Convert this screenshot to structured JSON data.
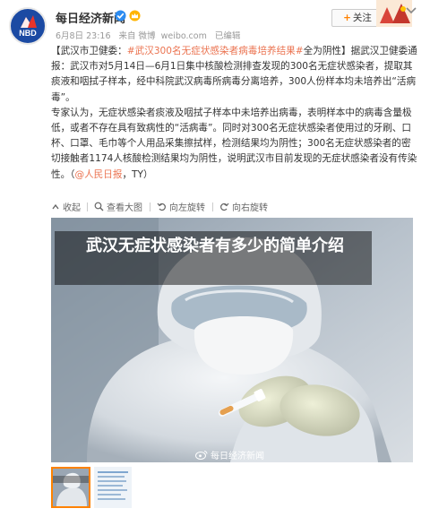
{
  "header": {
    "account_name": "每日经济新闻",
    "logo_text": "NBD",
    "meta": {
      "date": "6月8日 23:16",
      "source_prefix": "来自",
      "source": "微博",
      "domain": "weibo.com",
      "status": "已编辑"
    },
    "follow_label": "+关注",
    "follow_plus": "+",
    "follow_text": "关注"
  },
  "post": {
    "p1_open": "【",
    "p1_place": "武汉市卫健委",
    "p1_colon": "：",
    "p1_hashtag": "#武汉300名无症状感染者病毒培养结果#",
    "p1_bold": "全为阴性",
    "p1_close": "】",
    "p1_rest": "据武汉卫健委通报：武汉市对5月14日—6月1日集中核酸检测排查发现的300名无症状感染者，提取其痰液和咽拭子样本，经中科院武汉病毒所病毒分离培养，300人份样本均未培养出“活病毒”。",
    "p2": "专家认为，无症状感染者痰液及咽拭子样本中未培养出病毒，表明样本中的病毒含量极低，或者不存在具有致病性的“活病毒”。同时对300名无症状感染者使用过的牙刷、口杯、口罩、毛巾等个人用品采集擦拭样，检测结果均为阴性；300名无症状感染者的密切接触者1174人核酸检测结果均为阴性，说明武汉市目前发现的无症状感染者没有传染性。",
    "p2_link_open": "（",
    "p2_link": "@人民日报",
    "p2_link_close": "，TY）"
  },
  "actions": [
    {
      "label": "收起",
      "icon": "collapse-icon"
    },
    {
      "label": "查看大图",
      "icon": "zoom-icon"
    },
    {
      "label": "向左旋转",
      "icon": "rotate-left-icon"
    },
    {
      "label": "向右旋转",
      "icon": "rotate-right-icon"
    }
  ],
  "photo": {
    "title": "武汉无症状感染者有多少的简单介绍",
    "watermark": "每日经济新闻"
  },
  "colors": {
    "accent": "#eb7350",
    "brand": "#1b4aa3",
    "follow_plus": "#ff8200",
    "thumb_active": "#ff8200"
  }
}
